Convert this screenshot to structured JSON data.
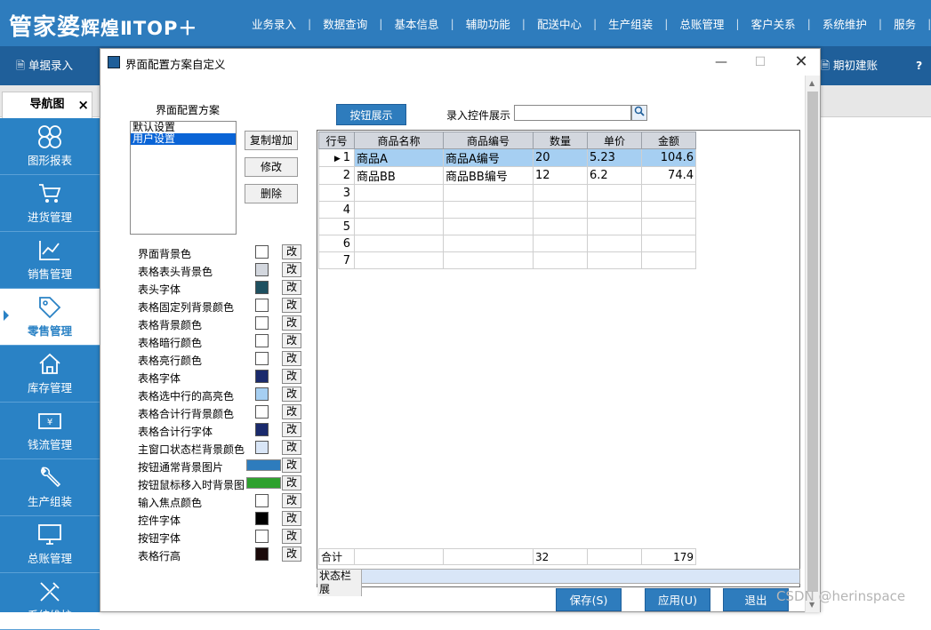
{
  "app": {
    "logo": "管家婆",
    "logo_sub": "辉煌ⅡTOP＋"
  },
  "menu": [
    "业务录入",
    "数据查询",
    "基本信息",
    "辅助功能",
    "配送中心",
    "生产组装",
    "总账管理",
    "客户关系",
    "系统维护",
    "服务"
  ],
  "toolbar": {
    "left_item": "单据录入",
    "right_item": "期初建账",
    "right_icon": "?"
  },
  "nav": {
    "tab": "导航图",
    "close": "×"
  },
  "sidebar": [
    {
      "label": "图形报表",
      "icon": "grid-icon"
    },
    {
      "label": "进货管理",
      "icon": "cart-icon"
    },
    {
      "label": "销售管理",
      "icon": "trend-chart-icon"
    },
    {
      "label": "零售管理",
      "icon": "tag-icon",
      "active": true
    },
    {
      "label": "库存管理",
      "icon": "house-icon"
    },
    {
      "label": "钱流管理",
      "icon": "money-icon"
    },
    {
      "label": "生产组装",
      "icon": "wrench-icon"
    },
    {
      "label": "总账管理",
      "icon": "monitor-icon"
    },
    {
      "label": "系统维护",
      "icon": "tools-icon"
    }
  ],
  "dialog": {
    "title": "界面配置方案自定义",
    "scheme_label": "界面配置方案",
    "schemes": [
      "默认设置",
      "用户设置"
    ],
    "selected_scheme": "用户设置",
    "buttons": {
      "copy_add": "复制增加",
      "modify": "修改",
      "delete": "删除"
    },
    "settings": [
      {
        "label": "界面背景色",
        "color": "#ffffff"
      },
      {
        "label": "表格表头背景色",
        "color": "#d3d7de"
      },
      {
        "label": "表头字体",
        "color": "#1e5060"
      },
      {
        "label": "表格固定列背景颜色",
        "color": "#ffffff"
      },
      {
        "label": "表格背景颜色",
        "color": "#ffffff"
      },
      {
        "label": "表格暗行颜色",
        "color": "#ffffff"
      },
      {
        "label": "表格亮行颜色",
        "color": "#ffffff"
      },
      {
        "label": "表格字体",
        "color": "#1a2a6c"
      },
      {
        "label": "表格选中行的高亮色",
        "color": "#a6cff2"
      },
      {
        "label": "表格合计行背景颜色",
        "color": "#ffffff"
      },
      {
        "label": "表格合计行字体",
        "color": "#1a2a6c"
      },
      {
        "label": "主窗口状态栏背景颜色",
        "color": "#d9e6f7"
      },
      {
        "label": "按钮通常背景图片",
        "color": "#2e7cbd",
        "wide": true
      },
      {
        "label": "按钮鼠标移入时背景图",
        "color": "#2ea12e",
        "wide": true
      },
      {
        "label": "输入焦点颜色",
        "color": "#ffffff"
      },
      {
        "label": "控件字体",
        "color": "#000000"
      },
      {
        "label": "按钮字体",
        "color": "#ffffff"
      },
      {
        "label": "表格行高",
        "color": "#1a0a0a"
      }
    ],
    "change_label": "改",
    "show_buttons": "按钮展示",
    "input_control_label": "录入控件展示",
    "grid": {
      "headers": [
        "行号",
        "商品名称",
        "商品编号",
        "数量",
        "单价",
        "金额"
      ],
      "rows": [
        [
          "1",
          "商品A",
          "商品A编号",
          "20",
          "5.23",
          "104.6"
        ],
        [
          "2",
          "商品BB",
          "商品BB编号",
          "12",
          "6.2",
          "74.4"
        ],
        [
          "3",
          "",
          "",
          "",
          "",
          ""
        ],
        [
          "4",
          "",
          "",
          "",
          "",
          ""
        ],
        [
          "5",
          "",
          "",
          "",
          "",
          ""
        ],
        [
          "6",
          "",
          "",
          "",
          "",
          ""
        ],
        [
          "7",
          "",
          "",
          "",
          "",
          ""
        ]
      ],
      "total": {
        "label": "合计",
        "qty": "32",
        "amount": "179"
      }
    },
    "status_label": "状态栏展",
    "footer": {
      "save": "保存(S)",
      "apply": "应用(U)",
      "exit": "退出"
    }
  },
  "watermark": "CSDN @herinspace"
}
